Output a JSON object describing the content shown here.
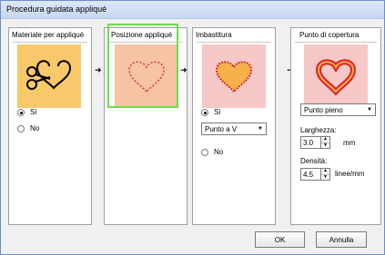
{
  "title": "Procedura guidata appliqué",
  "panels": {
    "materiale": {
      "title": "Materiale per appliqué",
      "icon": "scissors-heart-icon",
      "options": [
        {
          "label": "Sì",
          "selected": true
        },
        {
          "label": "No",
          "selected": false
        }
      ]
    },
    "posizione": {
      "title": "Posizione appliqué",
      "icon": "dotted-heart-icon"
    },
    "imbastitura": {
      "title": "Imbastitura",
      "icon": "outlined-heart-icon",
      "options": [
        {
          "label": "Sì",
          "selected": true
        },
        {
          "label": "No",
          "selected": false
        }
      ],
      "stitch_type": "Punto a V"
    },
    "copertura": {
      "title": "Punto di copertura",
      "icon": "satin-heart-icon",
      "stitch_type": "Punto pieno",
      "width_label": "Larghezza:",
      "width_value": "3.0",
      "width_unit": "mm",
      "density_label": "Densità:",
      "density_value": "4.5",
      "density_unit": "linee/mm"
    }
  },
  "buttons": {
    "ok": "OK",
    "cancel": "Annulla"
  },
  "colors": {
    "tile_orange": "#f7c96a",
    "tile_salmon": "#f6c3a5",
    "tile_pink": "#f6c8c8",
    "highlight_green": "#66e04a"
  }
}
